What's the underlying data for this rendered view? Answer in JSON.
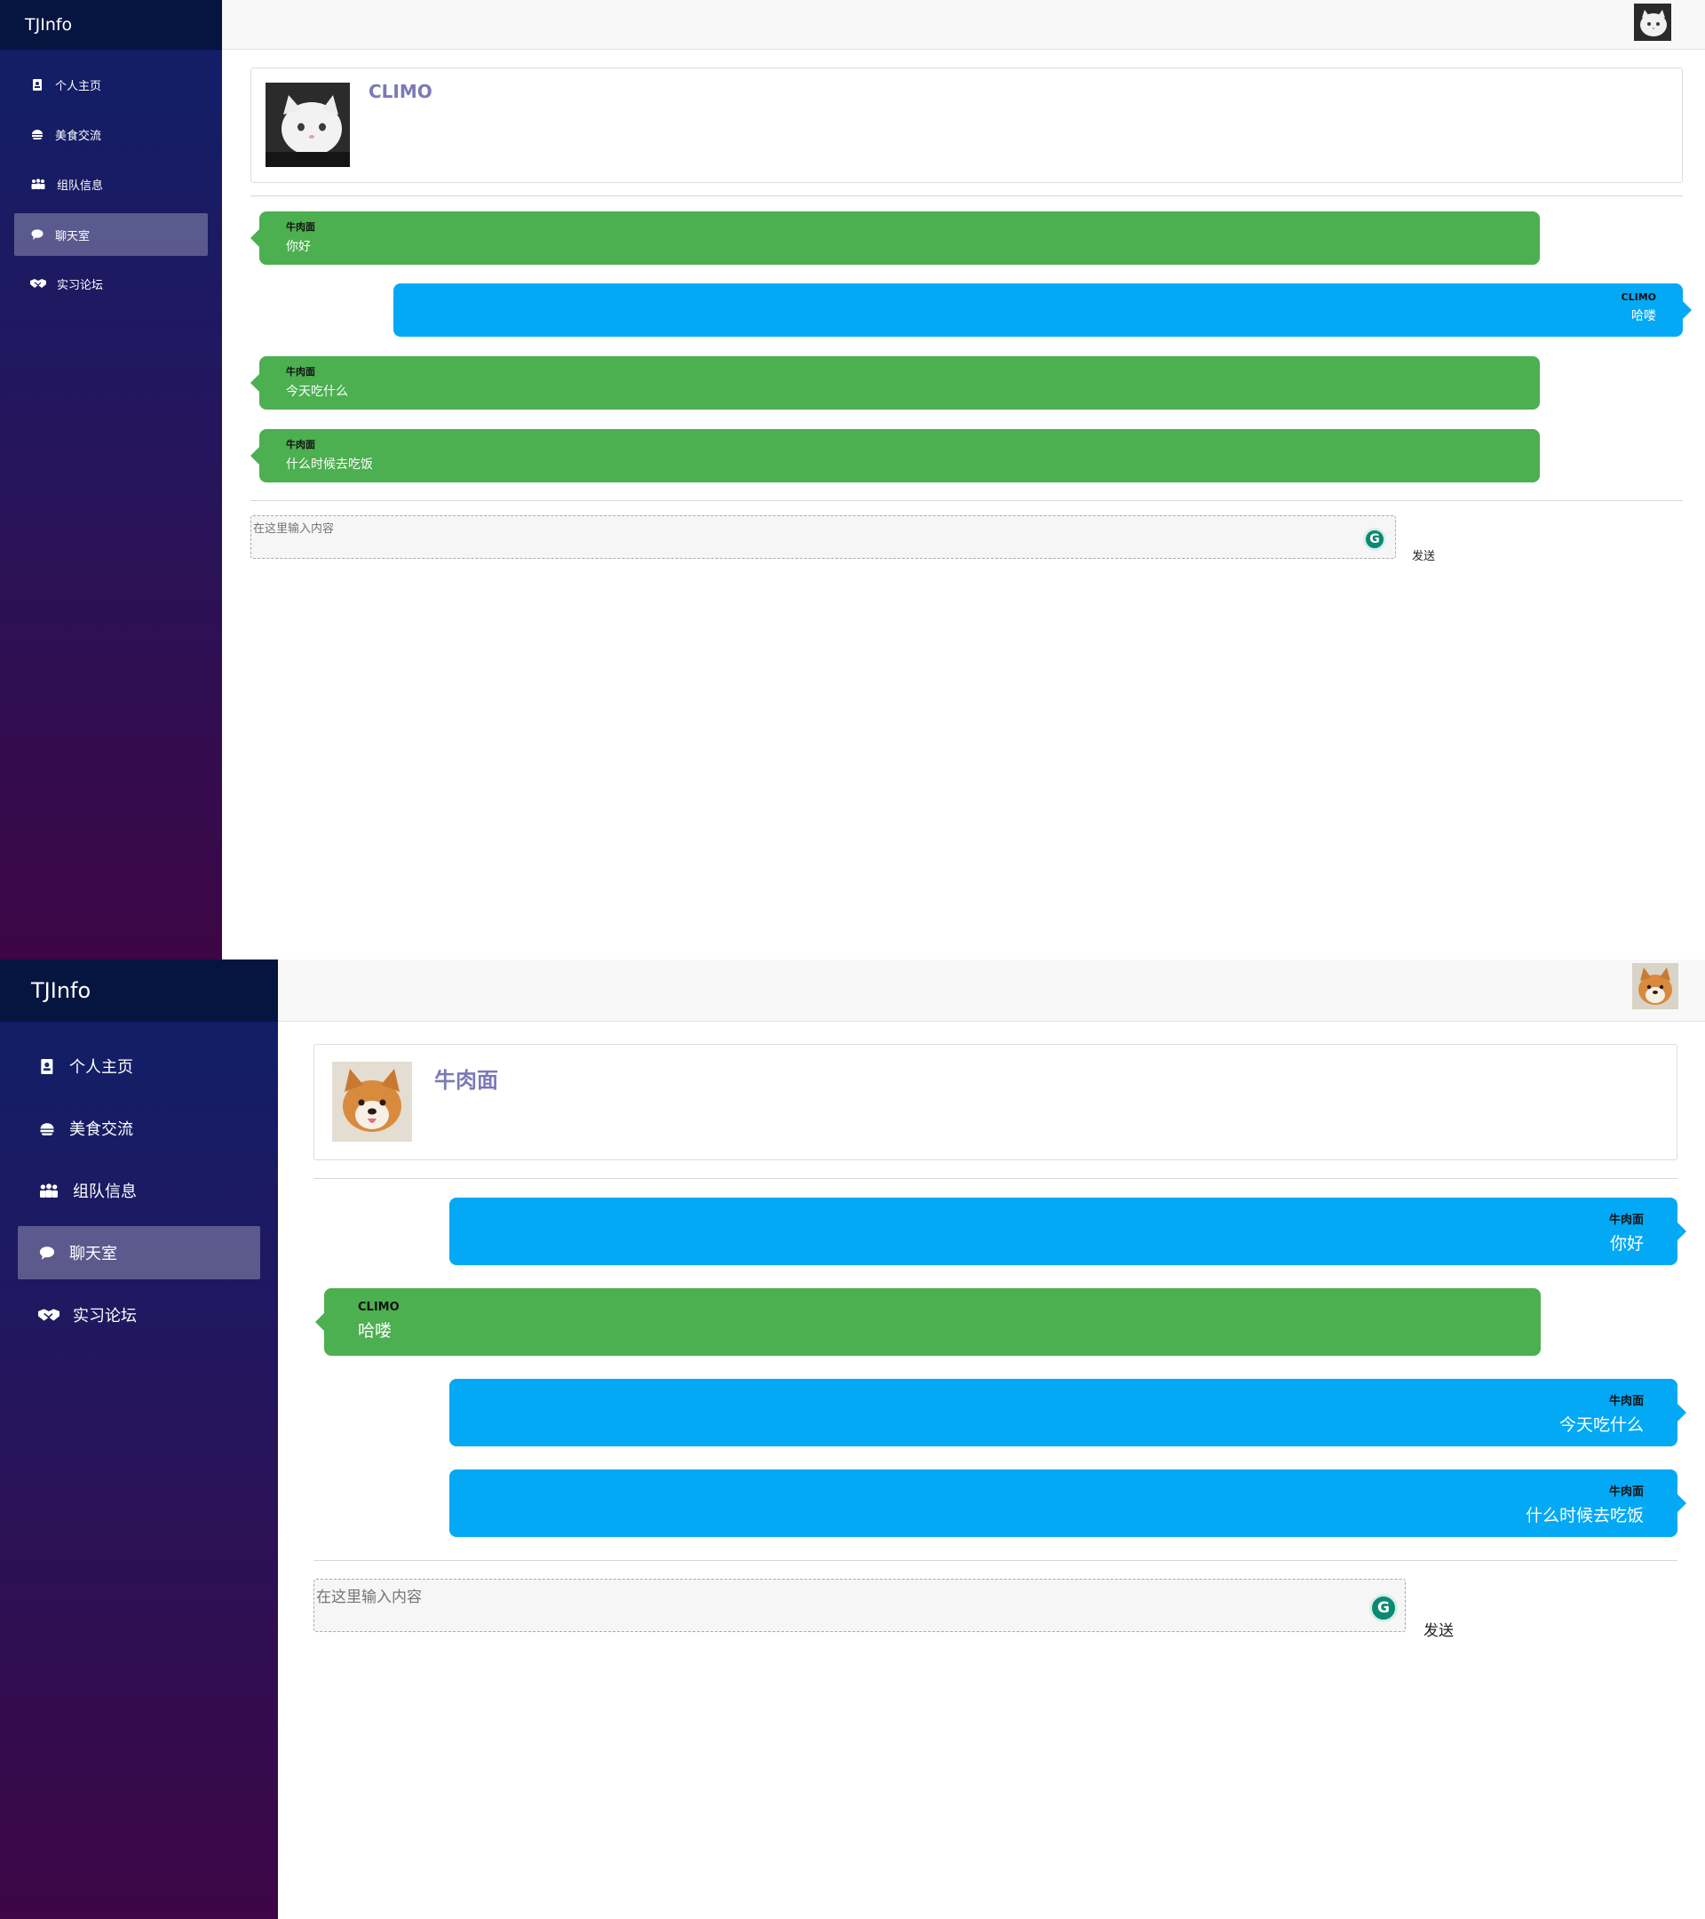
{
  "app": {
    "brand": "TJInfo"
  },
  "sidebar": {
    "items": [
      {
        "label": "个人主页",
        "icon": "profile-card-icon"
      },
      {
        "label": "美食交流",
        "icon": "food-icon"
      },
      {
        "label": "组队信息",
        "icon": "team-icon"
      },
      {
        "label": "聊天室",
        "icon": "chat-bubble-icon",
        "active": true
      },
      {
        "label": "实习论坛",
        "icon": "handshake-icon"
      }
    ]
  },
  "views": [
    {
      "user": {
        "name": "CLIMO",
        "avatar": "cat-avatar"
      },
      "messages": [
        {
          "sender": "牛肉面",
          "text": "你好",
          "side": "left",
          "color": "#4caf50"
        },
        {
          "sender": "CLIMO",
          "text": "哈喽",
          "side": "right",
          "color": "#03a9f4"
        },
        {
          "sender": "牛肉面",
          "text": "今天吃什么",
          "side": "left",
          "color": "#4caf50"
        },
        {
          "sender": "牛肉面",
          "text": "什么时候去吃饭",
          "side": "left",
          "color": "#4caf50"
        }
      ],
      "input": {
        "placeholder": "在这里输入内容"
      },
      "send_label": "发送"
    },
    {
      "user": {
        "name": "牛肉面",
        "avatar": "dog-avatar"
      },
      "messages": [
        {
          "sender": "牛肉面",
          "text": "你好",
          "side": "right",
          "color": "#03a9f4"
        },
        {
          "sender": "CLIMO",
          "text": "哈喽",
          "side": "left",
          "color": "#4caf50"
        },
        {
          "sender": "牛肉面",
          "text": "今天吃什么",
          "side": "right",
          "color": "#03a9f4"
        },
        {
          "sender": "牛肉面",
          "text": "什么时候去吃饭",
          "side": "right",
          "color": "#03a9f4"
        }
      ],
      "input": {
        "placeholder": "在这里输入内容"
      },
      "send_label": "发送"
    }
  ],
  "colors": {
    "accent_name": "#7b79b7",
    "sidebar_top": "#0f2068",
    "sidebar_bottom": "#3d0645"
  }
}
